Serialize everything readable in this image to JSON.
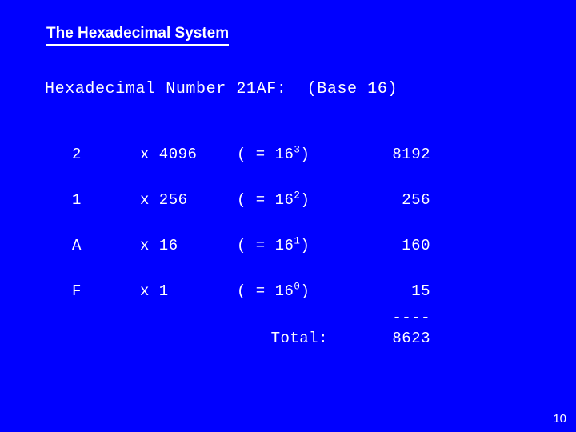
{
  "slide": {
    "background_color": "#0000FF",
    "text_color": "#FFFFFF",
    "title": "The Hexadecimal System",
    "subtitle": "Hexadecimal Number 21AF:  (Base 16)",
    "page_number": "10"
  },
  "table": {
    "rows": [
      {
        "digit": "2",
        "multiplier": "x 4096",
        "power_prefix": "( = 16",
        "power_exponent": "3",
        "power_suffix": ")",
        "value": "8192"
      },
      {
        "digit": "1",
        "multiplier": "x 256",
        "power_prefix": "( = 16",
        "power_exponent": "2",
        "power_suffix": ")",
        "value": "256"
      },
      {
        "digit": "A",
        "multiplier": "x 16",
        "power_prefix": "( = 16",
        "power_exponent": "1",
        "power_suffix": ")",
        "value": "160"
      },
      {
        "digit": "F",
        "multiplier": "x 1",
        "power_prefix": "( = 16",
        "power_exponent": "0",
        "power_suffix": ")",
        "value": "15"
      }
    ]
  },
  "totals": {
    "rule": "----",
    "label": "Total:",
    "value": "8623"
  }
}
